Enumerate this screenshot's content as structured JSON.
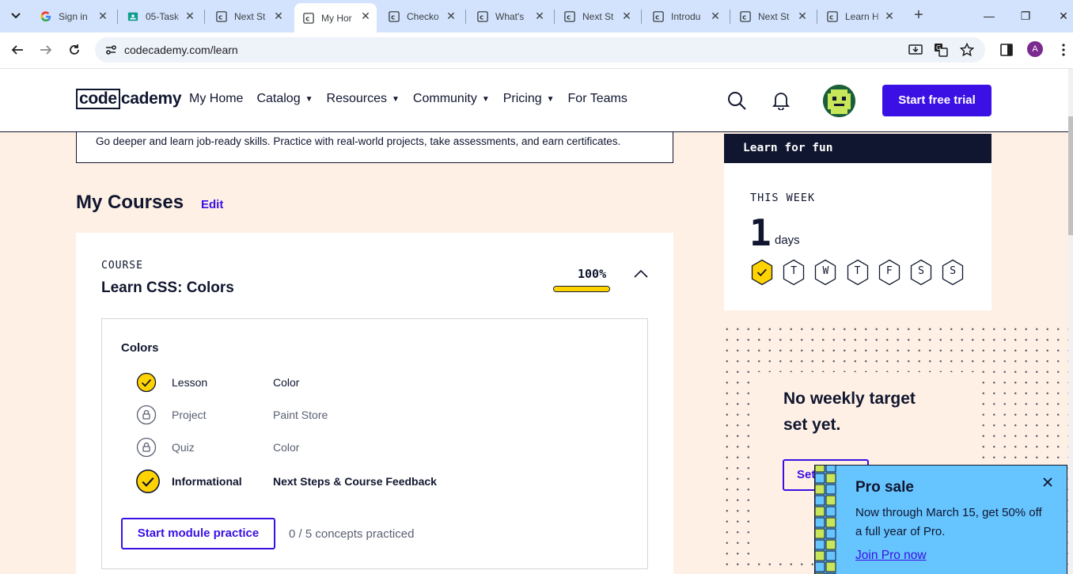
{
  "browser": {
    "tabs": [
      {
        "title": "Sign in",
        "favicon": "google-icon"
      },
      {
        "title": "05-Task",
        "favicon": "classroom-icon"
      },
      {
        "title": "Next St",
        "favicon": "codecademy-icon"
      },
      {
        "title": "My Hor",
        "favicon": "codecademy-icon",
        "active": true
      },
      {
        "title": "Checko",
        "favicon": "codecademy-icon"
      },
      {
        "title": "What's",
        "favicon": "codecademy-icon"
      },
      {
        "title": "Next St",
        "favicon": "codecademy-icon"
      },
      {
        "title": "Introdu",
        "favicon": "codecademy-icon"
      },
      {
        "title": "Next St",
        "favicon": "codecademy-icon"
      },
      {
        "title": "Learn H",
        "favicon": "codecademy-icon"
      }
    ],
    "new_tab": "+",
    "url": "codecademy.com/learn",
    "profile_initial": "A"
  },
  "site": {
    "logo_box": "code",
    "logo_rest": "cademy",
    "nav": [
      {
        "label": "My Home",
        "caret": false
      },
      {
        "label": "Catalog",
        "caret": true
      },
      {
        "label": "Resources",
        "caret": true
      },
      {
        "label": "Community",
        "caret": true
      },
      {
        "label": "Pricing",
        "caret": true
      },
      {
        "label": "For Teams",
        "caret": false
      }
    ],
    "trial_button": "Start free trial"
  },
  "promo_text": "Go deeper and learn job-ready skills. Practice with real-world projects, take assessments, and earn certificates.",
  "my_courses": {
    "title": "My Courses",
    "edit": "Edit"
  },
  "course": {
    "label": "COURSE",
    "name": "Learn CSS: Colors",
    "progress_text": "100%",
    "progress_value": 1.0,
    "module": {
      "title": "Colors",
      "items": [
        {
          "type": "Lesson",
          "name": "Color",
          "status": "complete"
        },
        {
          "type": "Project",
          "name": "Paint Store",
          "status": "locked"
        },
        {
          "type": "Quiz",
          "name": "Color",
          "status": "locked"
        },
        {
          "type": "Informational",
          "name": "Next Steps & Course Feedback",
          "status": "complete"
        }
      ],
      "practice_button": "Start module practice",
      "practice_meta": "0 / 5 concepts practiced"
    }
  },
  "learn_for_fun": {
    "header": "Learn for fun",
    "this_week": "THIS WEEK",
    "days_count": "1",
    "days_label": "days",
    "days": [
      {
        "letter": "",
        "done": true
      },
      {
        "letter": "T",
        "done": false
      },
      {
        "letter": "W",
        "done": false
      },
      {
        "letter": "T",
        "done": false
      },
      {
        "letter": "F",
        "done": false
      },
      {
        "letter": "S",
        "done": false
      },
      {
        "letter": "S",
        "done": false
      }
    ]
  },
  "weekly_target": {
    "title": "No weekly target set yet.",
    "button": "Set"
  },
  "pro_sale": {
    "title": "Pro sale",
    "text": "Now through March 15, get 50% off a full year of Pro.",
    "link": "Join Pro now"
  },
  "colors": {
    "brand": "#3a10e5",
    "navy": "#10162f",
    "yellow": "#ffd300",
    "page_bg": "#fff0e5",
    "pro_bg": "#66c4ff"
  }
}
